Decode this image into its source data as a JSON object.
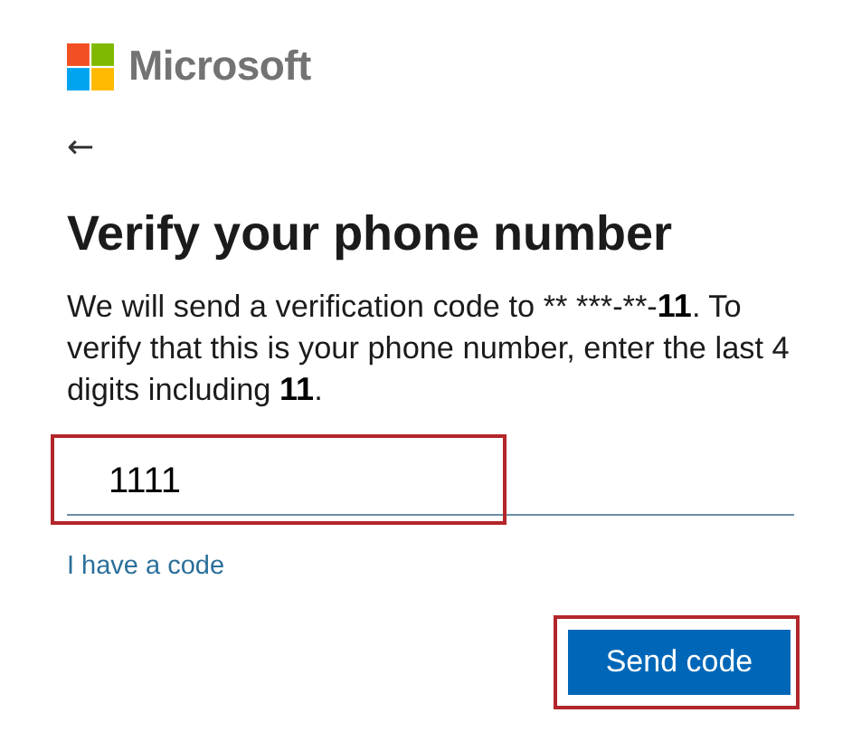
{
  "brand": {
    "name": "Microsoft"
  },
  "back": {
    "label": "←"
  },
  "title": "Verify your phone number",
  "description": [
    {
      "text": "We will send a verification code to ** ***-**-",
      "emphasis": false
    },
    {
      "text": "11",
      "emphasis": true
    },
    {
      "text": ". To verify that this is your phone number, enter the last 4 digits including ",
      "emphasis": false
    },
    {
      "text": "11",
      "emphasis": true
    },
    {
      "text": ".",
      "emphasis": false
    }
  ],
  "field": {
    "value": "1111",
    "highlighted": true
  },
  "link": "I have a code",
  "button": {
    "label": "Send code",
    "highlighted": true
  }
}
